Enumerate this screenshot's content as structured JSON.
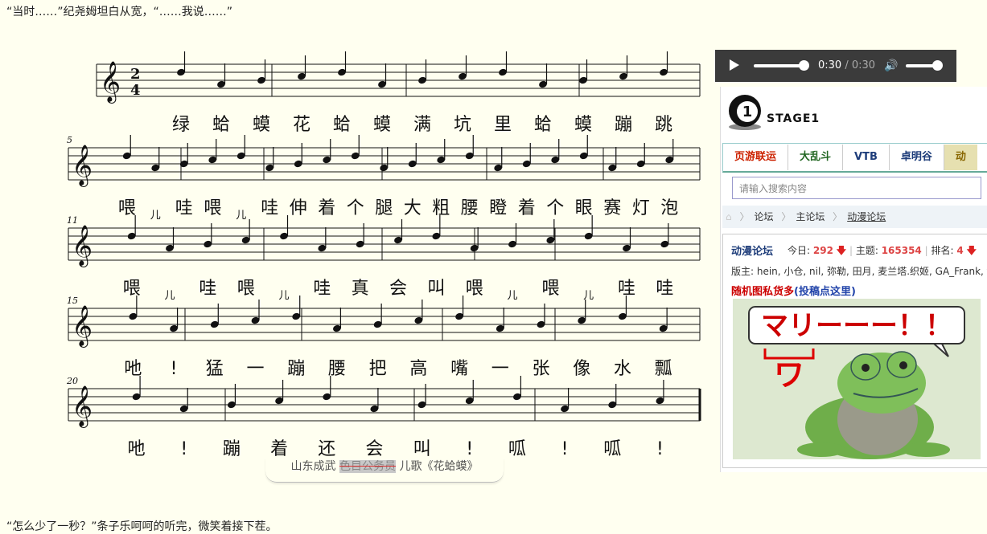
{
  "story": {
    "line1": "“当时……”纪尧姆坦白从宽，“……我说……”",
    "line2": "“怎么少了一秒？”条子乐呵呵的听完，微笑着接下茬。"
  },
  "score": {
    "time_signature": [
      "2",
      "4"
    ],
    "measure_numbers": [
      "5",
      "11",
      "15",
      "20"
    ],
    "lyrics": {
      "row1": [
        "绿",
        "蛤",
        "蟆",
        "花",
        "蛤",
        "蟆",
        "满",
        "坑",
        "里",
        "蛤",
        "蟆",
        "蹦",
        "跳"
      ],
      "row2": [
        "喂",
        "儿",
        "哇",
        "喂",
        "儿",
        "哇",
        "伸",
        "着",
        "个",
        "腿",
        "大",
        "粗",
        "腰",
        "瞪",
        "着",
        "个",
        "眼",
        "赛",
        "灯",
        "泡"
      ],
      "row3": [
        "喂",
        "儿",
        "哇",
        "喂",
        "儿",
        "哇",
        "真",
        "会",
        "叫",
        "喂",
        "儿",
        "喂",
        "儿",
        "哇",
        "哇"
      ],
      "row4": [
        "吔",
        "!",
        "猛",
        "一",
        "蹦",
        "腰",
        "把",
        "高",
        "嘴",
        "一",
        "张",
        "像",
        "水",
        "瓢"
      ],
      "row5": [
        "吔",
        "!",
        "蹦",
        "着",
        "还",
        "会",
        "叫",
        "!",
        "呱",
        "!",
        "呱",
        "!"
      ]
    }
  },
  "caption": {
    "prefix": "山东成武",
    "struck": "色目公务员",
    "suffix": "儿歌《花蛤蟆》"
  },
  "player": {
    "current_time": "0:30",
    "separator": " / ",
    "duration": "0:30",
    "progress": 1.0,
    "volume": 0.75
  },
  "forum": {
    "site_name": "STAGE1",
    "logo_digit": "1",
    "nav": [
      "页游联运",
      "大乱斗",
      "VTB",
      "卓明谷",
      "动"
    ],
    "nav_colors": [
      "#cc2200",
      "#226622",
      "#1e3d7a",
      "#1e3d7a",
      "#886600"
    ],
    "search_placeholder": "请输入搜索内容",
    "breadcrumb": [
      "论坛",
      "主论坛",
      "动漫论坛"
    ],
    "board": {
      "name": "动漫论坛",
      "today_label": "今日:",
      "today": "292",
      "topics_label": "主题:",
      "topics": "165354",
      "rank_label": "排名:",
      "rank": "4",
      "moderators": "版主: hein, 小仓, nil, 弥勒, 田月, 麦兰塔.织姬, GA_Frank, t",
      "random_label": "随机图私货多",
      "random_sub": "(投稿点这里)"
    },
    "image_text": "マリーーー！！",
    "image_text2": "ワ"
  }
}
